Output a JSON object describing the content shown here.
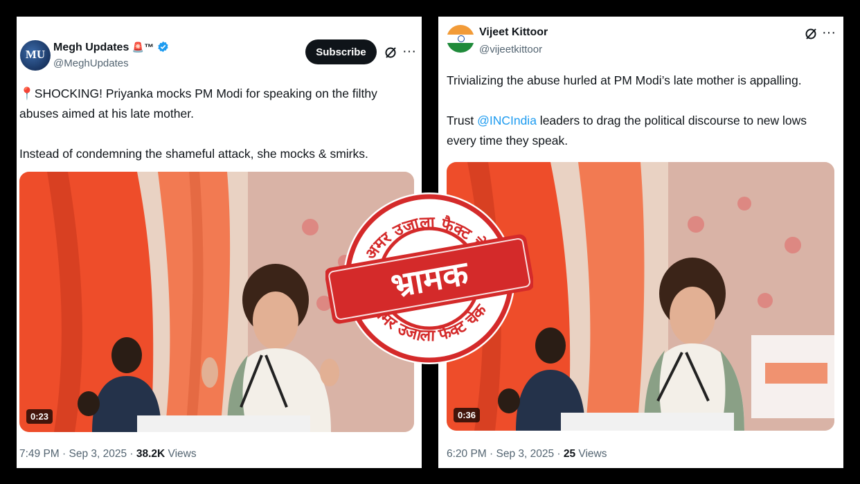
{
  "left_tweet": {
    "display_name": "Megh Updates",
    "name_suffix": "🚨™",
    "handle": "@MeghUpdates",
    "avatar_text": "MU",
    "subscribe_label": "Subscribe",
    "text_line1": "📍SHOCKING! Priyanka mocks PM Modi for speaking on the filthy abuses aimed at his late mother.",
    "text_line2": "Instead of condemning the shameful attack, she mocks & smirks.",
    "video_duration": "0:23",
    "timestamp": "7:49 PM · Sep 3, 2025 · ",
    "views_count": "38.2K",
    "views_label": " Views"
  },
  "right_tweet": {
    "display_name": "Vijeet Kittoor",
    "handle": "@vijeetkittoor",
    "text_line1": "Trivializing the abuse hurled at PM Modi’s late mother is appalling.",
    "text_line2_prefix": "Trust ",
    "text_line2_mention": "@INCIndia",
    "text_line2_suffix": " leaders to drag the political discourse to new lows every time they speak.",
    "video_duration": "0:36",
    "timestamp": "6:20 PM · Sep 3, 2025 · ",
    "views_count": "25",
    "views_label": " Views"
  },
  "stamp": {
    "top_text": "अमर उजाला फैक्ट चेक",
    "main_text": "भ्रामक",
    "bottom_text": "अमर उजाला फैक्ट चेक"
  },
  "colors": {
    "stamp_red": "#d42a2a",
    "verified_blue": "#1d9bf0",
    "curtain_orange": "#ee5a2b"
  },
  "icons": [
    "verified-badge-icon",
    "grok-icon",
    "more-icon",
    "india-flag-avatar"
  ]
}
